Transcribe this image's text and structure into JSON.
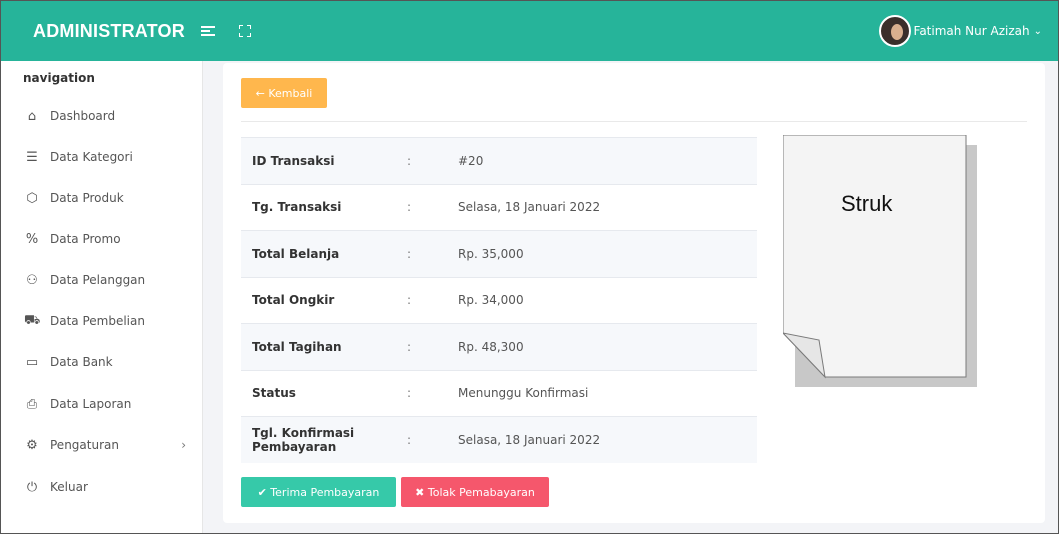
{
  "topbar": {
    "brand": "ADMINISTRATOR",
    "user_name": "Fatimah Nur Azizah",
    "caret": "⌄",
    "color": "#26b49a"
  },
  "sidebar": {
    "title": "navigation",
    "items": [
      {
        "label": "Dashboard",
        "icon": "home-icon"
      },
      {
        "label": "Data Kategori",
        "icon": "list-icon"
      },
      {
        "label": "Data Produk",
        "icon": "box-icon"
      },
      {
        "label": "Data Promo",
        "icon": "percent-icon"
      },
      {
        "label": "Data Pelanggan",
        "icon": "users-icon"
      },
      {
        "label": "Data Pembelian",
        "icon": "cart-icon"
      },
      {
        "label": "Data Bank",
        "icon": "card-icon"
      },
      {
        "label": "Data Laporan",
        "icon": "printer-icon"
      },
      {
        "label": "Pengaturan",
        "icon": "gear-icon",
        "arrow": "›"
      },
      {
        "label": "Keluar",
        "icon": "power-icon"
      }
    ]
  },
  "main": {
    "back_label": "← Kembali",
    "rows": [
      {
        "key": "ID Transaksi",
        "sep": ":",
        "value": "#20"
      },
      {
        "key": "Tg. Transaksi",
        "sep": ":",
        "value": "Selasa, 18 Januari 2022"
      },
      {
        "key": "Total Belanja",
        "sep": ":",
        "value": "Rp. 35,000"
      },
      {
        "key": "Total Ongkir",
        "sep": ":",
        "value": "Rp. 34,000"
      },
      {
        "key": "Total Tagihan",
        "sep": ":",
        "value": "Rp. 48,300"
      },
      {
        "key": "Status",
        "sep": ":",
        "value": "Menunggu Konfirmasi"
      },
      {
        "key": "Tgl. Konfirmasi Pembayaran",
        "sep": ":",
        "value": "Selasa, 18 Januari 2022"
      }
    ],
    "accept_label": "✔ Terima Pembayaran",
    "reject_label": "✖ Tolak Pemabayaran",
    "receipt_label": "Struk"
  }
}
